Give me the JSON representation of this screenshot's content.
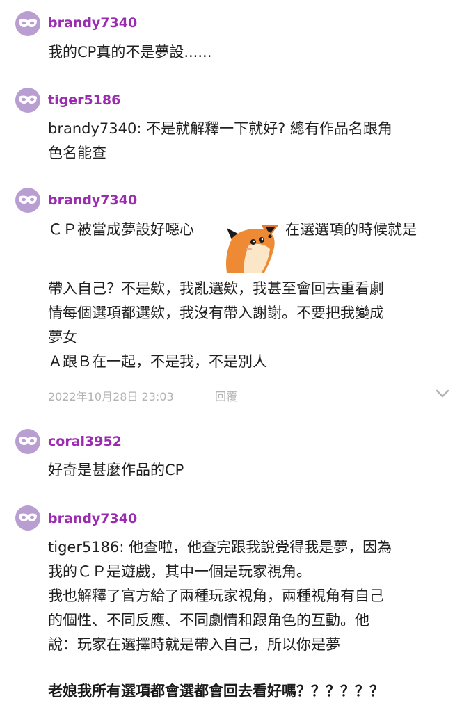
{
  "comments": [
    {
      "username": "brandy7340",
      "lines": [
        "我的CP真的不是夢設......"
      ]
    },
    {
      "username": "tiger5186",
      "lines": [
        "brandy7340: 不是就解釋一下就好? 總有作品名跟角",
        "色名能查"
      ]
    },
    {
      "username": "brandy7340",
      "line1_before_sticker": "ＣＰ被當成夢設好噁心",
      "line1_after_sticker": "在選選項的時候就是",
      "lines": [
        "帶入自己？不是欸，我亂選欸，我甚至會回去重看劇",
        "情每個選項都選欸，我沒有帶入謝謝。不要把我變成",
        "夢女",
        "Ａ跟Ｂ在一起，不是我，不是別人"
      ],
      "timestamp": "2022年10月28日 23:03",
      "reply_label": "回覆",
      "sticker_icon": "fox-sticker-icon"
    },
    {
      "username": "coral3952",
      "lines": [
        "好奇是甚麼作品的CP"
      ]
    },
    {
      "username": "brandy7340",
      "lines": [
        "tiger5186: 他查啦，他查完跟我說覺得我是夢，因為",
        "我的ＣＰ是遊戲，其中一個是玩家視角。",
        "我也解釋了官方給了兩種玩家視角，兩種視角有自己",
        "的個性、不同反應、不同劇情和跟角色的互動。他",
        "說：玩家在選擇時就是帶入自己，所以你是夢"
      ]
    }
  ],
  "footer_text": "老娘我所有選項都會選都會回去看好嗎？？？？？？",
  "avatar_icon": "mask-icon",
  "colors": {
    "username": "#9b2bb0",
    "avatar_bg": "#b99fd1",
    "meta": "#b3b3b3"
  }
}
